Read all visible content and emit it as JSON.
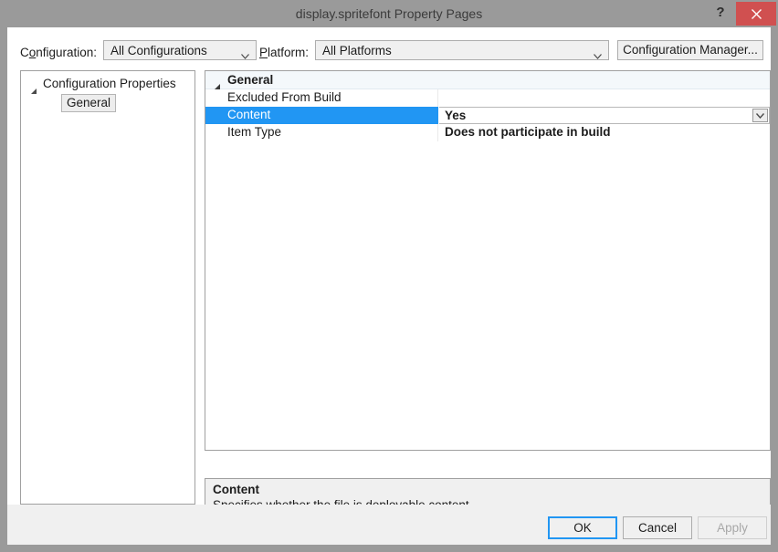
{
  "window": {
    "title": "display.spritefont Property Pages",
    "help_label": "?",
    "close_label": "close-icon",
    "accent_blue": "#2196f3",
    "close_red": "#d05050",
    "titlebar_gray": "#9a9a9a"
  },
  "config_bar": {
    "configuration_label_pre": "C",
    "configuration_label_acc": "o",
    "configuration_label_post": "nfiguration:",
    "configuration_value": "All Configurations",
    "platform_label_pre": "",
    "platform_label_acc": "P",
    "platform_label_post": "latform:",
    "platform_value": "All Platforms",
    "configuration_manager_pre": "C",
    "configuration_manager_acc": "o",
    "configuration_manager_post": "nfiguration Manager..."
  },
  "tree": {
    "root_label": "Configuration Properties",
    "child_label": "General"
  },
  "grid": {
    "category_label": "General",
    "rows": [
      {
        "name": "Excluded From Build",
        "value": "",
        "selected": false,
        "has_dropdown": false
      },
      {
        "name": "Content",
        "value": "Yes",
        "selected": true,
        "has_dropdown": true
      },
      {
        "name": "Item Type",
        "value": "Does not participate in build",
        "selected": false,
        "has_dropdown": false
      }
    ]
  },
  "description": {
    "title": "Content",
    "text": "Specifies whether the file is deployable content."
  },
  "footer": {
    "ok_label": "OK",
    "cancel_label": "Cancel",
    "apply_label_pre": "",
    "apply_label_acc": "A",
    "apply_label_post": "pply"
  }
}
